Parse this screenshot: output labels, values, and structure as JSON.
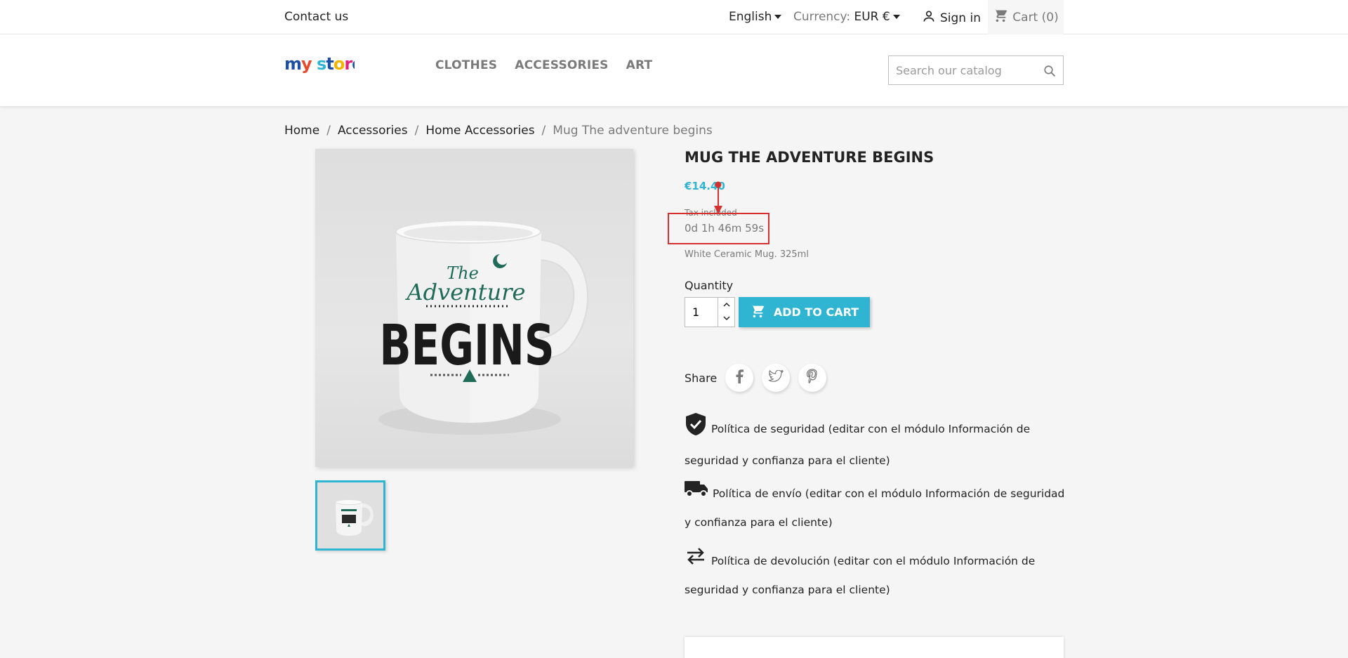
{
  "topbar": {
    "contact": "Contact us",
    "language": "English",
    "currency_label": "Currency:",
    "currency_value": "EUR €",
    "sign_in": "Sign in",
    "cart": "Cart (0)"
  },
  "header": {
    "logo_text": "my store",
    "nav": [
      "CLOTHES",
      "ACCESSORIES",
      "ART"
    ],
    "search_placeholder": "Search our catalog"
  },
  "breadcrumb": [
    "Home",
    "Accessories",
    "Home Accessories",
    "Mug The adventure begins"
  ],
  "product": {
    "title": "Mug The adventure begins",
    "price": "€14.40",
    "tax_note": "Tax included",
    "countdown": "0d 1h 46m 59s",
    "short_description": "White Ceramic Mug. 325ml",
    "mug_text": {
      "line1": "The",
      "line2": "Adventure",
      "line3": "BEGINS"
    },
    "quantity_label": "Quantity",
    "quantity_value": "1",
    "add_to_cart": "ADD TO CART",
    "share_label": "Share"
  },
  "policies": [
    {
      "icon": "shield-check-icon",
      "text": "Política de seguridad (editar con el módulo Información de seguridad y confianza para el cliente)"
    },
    {
      "icon": "truck-icon",
      "text": "Política de envío (editar con el módulo Información de seguridad y confianza para el cliente)"
    },
    {
      "icon": "exchange-arrows-icon",
      "text": "Política de devolución (editar con el módulo Información de seguridad y confianza para el cliente)"
    }
  ],
  "colors": {
    "accent": "#2fb5d2",
    "annotation": "#d62f2f",
    "mug_green": "#1f6b58"
  }
}
